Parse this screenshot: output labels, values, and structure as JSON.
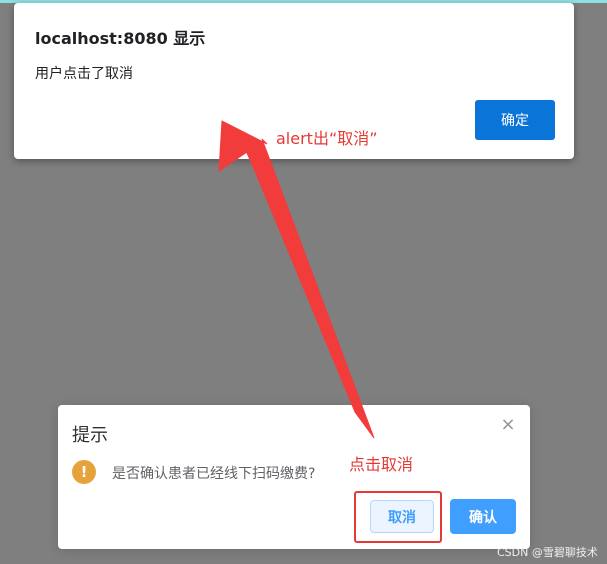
{
  "alert": {
    "title": "localhost:8080 显示",
    "message": "用户点击了取消",
    "ok_label": "确定"
  },
  "confirm": {
    "title": "提示",
    "close_symbol": "×",
    "warning_symbol": "!",
    "message": "是否确认患者已经线下扫码缴费?",
    "cancel_label": "取消",
    "confirm_label": "确认"
  },
  "annotations": {
    "alert_note": "alert出“取消”",
    "click_note": "点击取消",
    "color": "#e53935"
  },
  "watermark": "CSDN @雪碧聊技术",
  "colors": {
    "overlay": "#7f7f7f",
    "alert_button": "#0b74d8",
    "primary": "#409eff",
    "warning": "#e6a23c"
  }
}
